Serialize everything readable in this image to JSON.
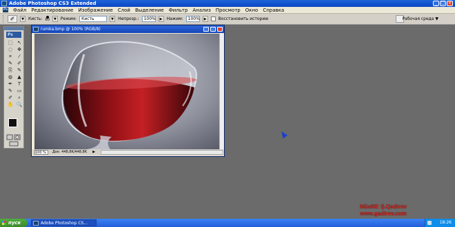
{
  "app": {
    "title": "Adobe Photoshop CS3 Extended"
  },
  "menu": {
    "items": [
      "Файл",
      "Редактирование",
      "Изображение",
      "Слой",
      "Выделение",
      "Фильтр",
      "Анализ",
      "Просмотр",
      "Окно",
      "Справка"
    ]
  },
  "options": {
    "brush_label": "Кисть:",
    "brush_size": "60",
    "mode_label": "Режим:",
    "mode_value": "Кисть",
    "opacity_label": "Непрозр.:",
    "opacity_value": "100%",
    "flow_label": "Нажим:",
    "flow_value": "100%",
    "history_label": "Восстановить историю",
    "workspace_label": "Рабочая среда ▼"
  },
  "toolbox": {
    "logo": "Ps",
    "tools": [
      "⬚",
      "↖",
      "◌",
      "✥",
      "⌗",
      "⁄",
      "✎",
      "✐",
      "⎘",
      "✎",
      "◍",
      "▲",
      "✒",
      "T",
      "✎",
      "▭",
      "✐",
      "⌕",
      "✋",
      "🔍"
    ]
  },
  "document": {
    "title": "rumka.bmp @ 100% (RGB/8)",
    "zoom": "100 %",
    "doc_info": "Док: 448,8K/448,8K"
  },
  "watermark": {
    "line1": "Müəllif: Ş.Qədirov",
    "line2": "www.gadirov.com"
  },
  "taskbar": {
    "start_label": "пуск",
    "task_label": "Adobe Photoshop CS...",
    "clock": "18:26"
  }
}
